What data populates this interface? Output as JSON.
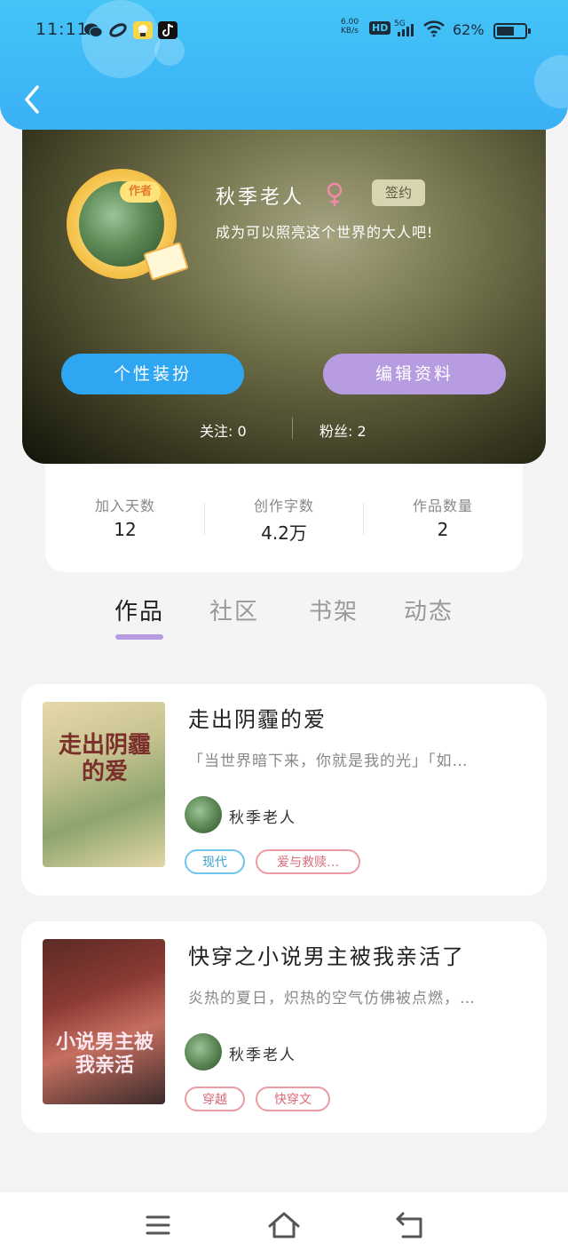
{
  "status_bar": {
    "time": "11:11",
    "net_speed": "6.00\nKB/s",
    "hd": "HD",
    "signal": "5G",
    "battery": "62%",
    "battery_level": 0.62
  },
  "profile": {
    "author_badge": "作者",
    "username": "秋季老人",
    "sign_badge": "签约",
    "motto": "成为可以照亮这个世界的大人吧!",
    "style_button": "个性装扮",
    "edit_button": "编辑资料",
    "following": "关注: 0",
    "fans": "粉丝: 2"
  },
  "stats": [
    {
      "label": "加入天数",
      "value": "12"
    },
    {
      "label": "创作字数",
      "value": "4.2万"
    },
    {
      "label": "作品数量",
      "value": "2"
    }
  ],
  "tabs": [
    "作品",
    "社区",
    "书架",
    "动态"
  ],
  "books": [
    {
      "title": "走出阴霾的爱",
      "description": "「当世界暗下来，你就是我的光」「如…",
      "author": "秋季老人",
      "cover_text": "走出阴霾的爱",
      "tags": [
        "现代",
        "爱与救赎…"
      ]
    },
    {
      "title": "快穿之小说男主被我亲活了",
      "description": "炎热的夏日，炽热的空气仿佛被点燃，…",
      "author": "秋季老人",
      "cover_text": "小说男主被我亲活",
      "tags": [
        "穿越",
        "快穿文"
      ]
    }
  ],
  "colors": {
    "header_blue": "#3ab0f5",
    "style_button": "#2fa6f2",
    "edit_button": "#b89ce2",
    "tab_indicator": "#b89ce2"
  }
}
